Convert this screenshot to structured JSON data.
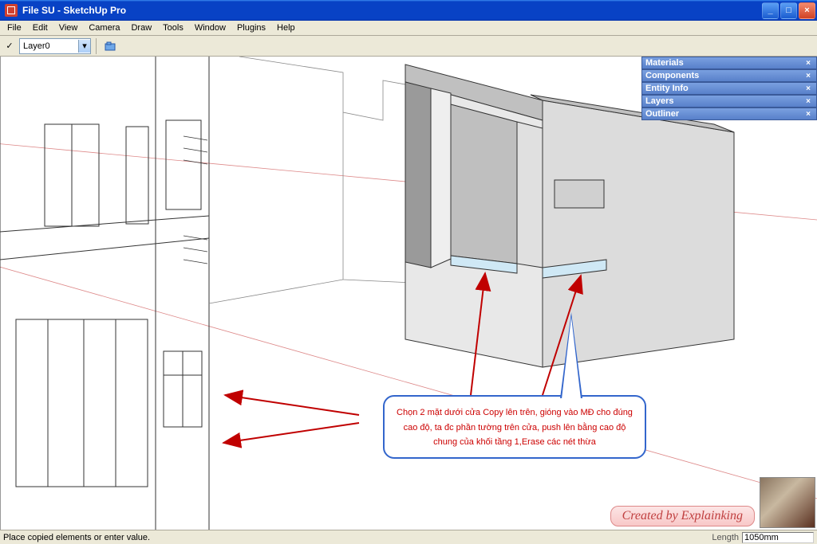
{
  "window": {
    "title": "File SU - SketchUp Pro",
    "buttons": {
      "min": "_",
      "max": "□",
      "close": "×"
    }
  },
  "menu": [
    "File",
    "Edit",
    "View",
    "Camera",
    "Draw",
    "Tools",
    "Window",
    "Plugins",
    "Help"
  ],
  "toolbar": {
    "layer_check": "✓",
    "layer_current": "Layer0",
    "dropdown_arrow": "▾"
  },
  "panels": [
    {
      "title": "Materials",
      "close": "×"
    },
    {
      "title": "Components",
      "close": "×"
    },
    {
      "title": "Entity Info",
      "close": "×"
    },
    {
      "title": "Layers",
      "close": "×"
    },
    {
      "title": "Outliner",
      "close": "×"
    }
  ],
  "callout": {
    "text": "Chọn 2 mặt dưới cửa Copy lên trên, gióng vào MĐ cho đúng cao độ, ta đc phần tường trên cửa, push lên bằng cao độ chung của khối tầng 1,Erase các nét thừa"
  },
  "status": {
    "message": "Place copied elements or enter value.",
    "vcb_label": "Length",
    "vcb_value": "1050mm"
  },
  "watermark": "Created by Explainking",
  "colors": {
    "titlebar": "#0842c5",
    "panel": "#5880ca",
    "callout_border": "#3366cc",
    "callout_text": "#cc0000",
    "arrow": "#c00000"
  }
}
